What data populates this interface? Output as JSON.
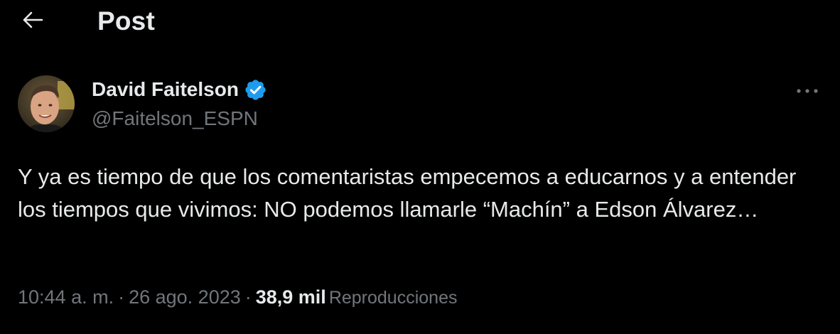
{
  "header": {
    "title": "Post",
    "back_icon": "arrow-left-icon"
  },
  "author": {
    "name": "David Faitelson",
    "handle": "@Faitelson_ESPN",
    "verified_icon": "verified-badge-icon",
    "verified_color": "#1d9bf0"
  },
  "tweet": {
    "text": "Y ya es tiempo de que los comentaristas empecemos a educarnos y a entender los tiempos que vivimos: NO podemos llamarle “Machín” a Edson Álvarez…"
  },
  "meta": {
    "time": "10:44 a. m.",
    "separator": "·",
    "date": "26 ago. 2023",
    "views_count": "38,9 mil",
    "views_label": "Reproducciones"
  },
  "actions": {
    "more_icon": "more-horizontal-icon"
  },
  "colors": {
    "background": "#000000",
    "primary_text": "#e7e9ea",
    "secondary_text": "#71767b"
  }
}
